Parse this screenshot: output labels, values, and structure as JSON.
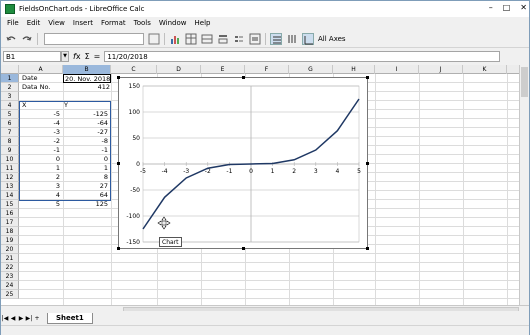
{
  "window": {
    "title": "FieldsOnChart.ods - LibreOffice Calc"
  },
  "menu": [
    "File",
    "Edit",
    "View",
    "Insert",
    "Format",
    "Tools",
    "Window",
    "Help"
  ],
  "toolbar": {
    "axes_label": "All Axes"
  },
  "formula": {
    "name_box": "B1",
    "sum_glyph": "Σ",
    "equals_glyph": "=",
    "content": "11/20/2018"
  },
  "columns": [
    "A",
    "B",
    "C",
    "D",
    "E",
    "F",
    "G",
    "H",
    "I",
    "J",
    "K"
  ],
  "rows": [
    "1",
    "2",
    "3",
    "4",
    "5",
    "6",
    "7",
    "8",
    "9",
    "10",
    "11",
    "12",
    "13",
    "14",
    "15",
    "16",
    "17",
    "18",
    "19",
    "20",
    "21",
    "22",
    "23",
    "24",
    "25"
  ],
  "cells": {
    "a1": "Date",
    "b1": "20. Nov. 2018",
    "a2": "Data No.",
    "b2": "412",
    "a4": "X",
    "b4": "Y",
    "x": [
      "-5",
      "-4",
      "-3",
      "-2",
      "-1",
      "0",
      "1",
      "2",
      "3",
      "4",
      "5"
    ],
    "y": [
      "-125",
      "-64",
      "-27",
      "-8",
      "-1",
      "0",
      "1",
      "8",
      "27",
      "64",
      "125"
    ]
  },
  "chart_data": {
    "type": "line",
    "x": [
      -5,
      -4,
      -3,
      -2,
      -1,
      0,
      1,
      2,
      3,
      4,
      5
    ],
    "series": [
      {
        "values": [
          -125,
          -64,
          -27,
          -8,
          -1,
          0,
          1,
          8,
          27,
          64,
          125
        ]
      }
    ],
    "xlim": [
      -5,
      5
    ],
    "ylim": [
      -150,
      150
    ],
    "x_ticks": [
      "-5",
      "-4",
      "-3",
      "-2",
      "-1",
      "0",
      "1",
      "2",
      "3",
      "4",
      "5"
    ],
    "y_ticks": [
      "150",
      "100",
      "50",
      "0",
      "-50",
      "-100",
      "-150"
    ],
    "grid": true,
    "line_color": "#1f3864"
  },
  "tooltip": "Chart",
  "sheet": {
    "tab": "Sheet1"
  }
}
